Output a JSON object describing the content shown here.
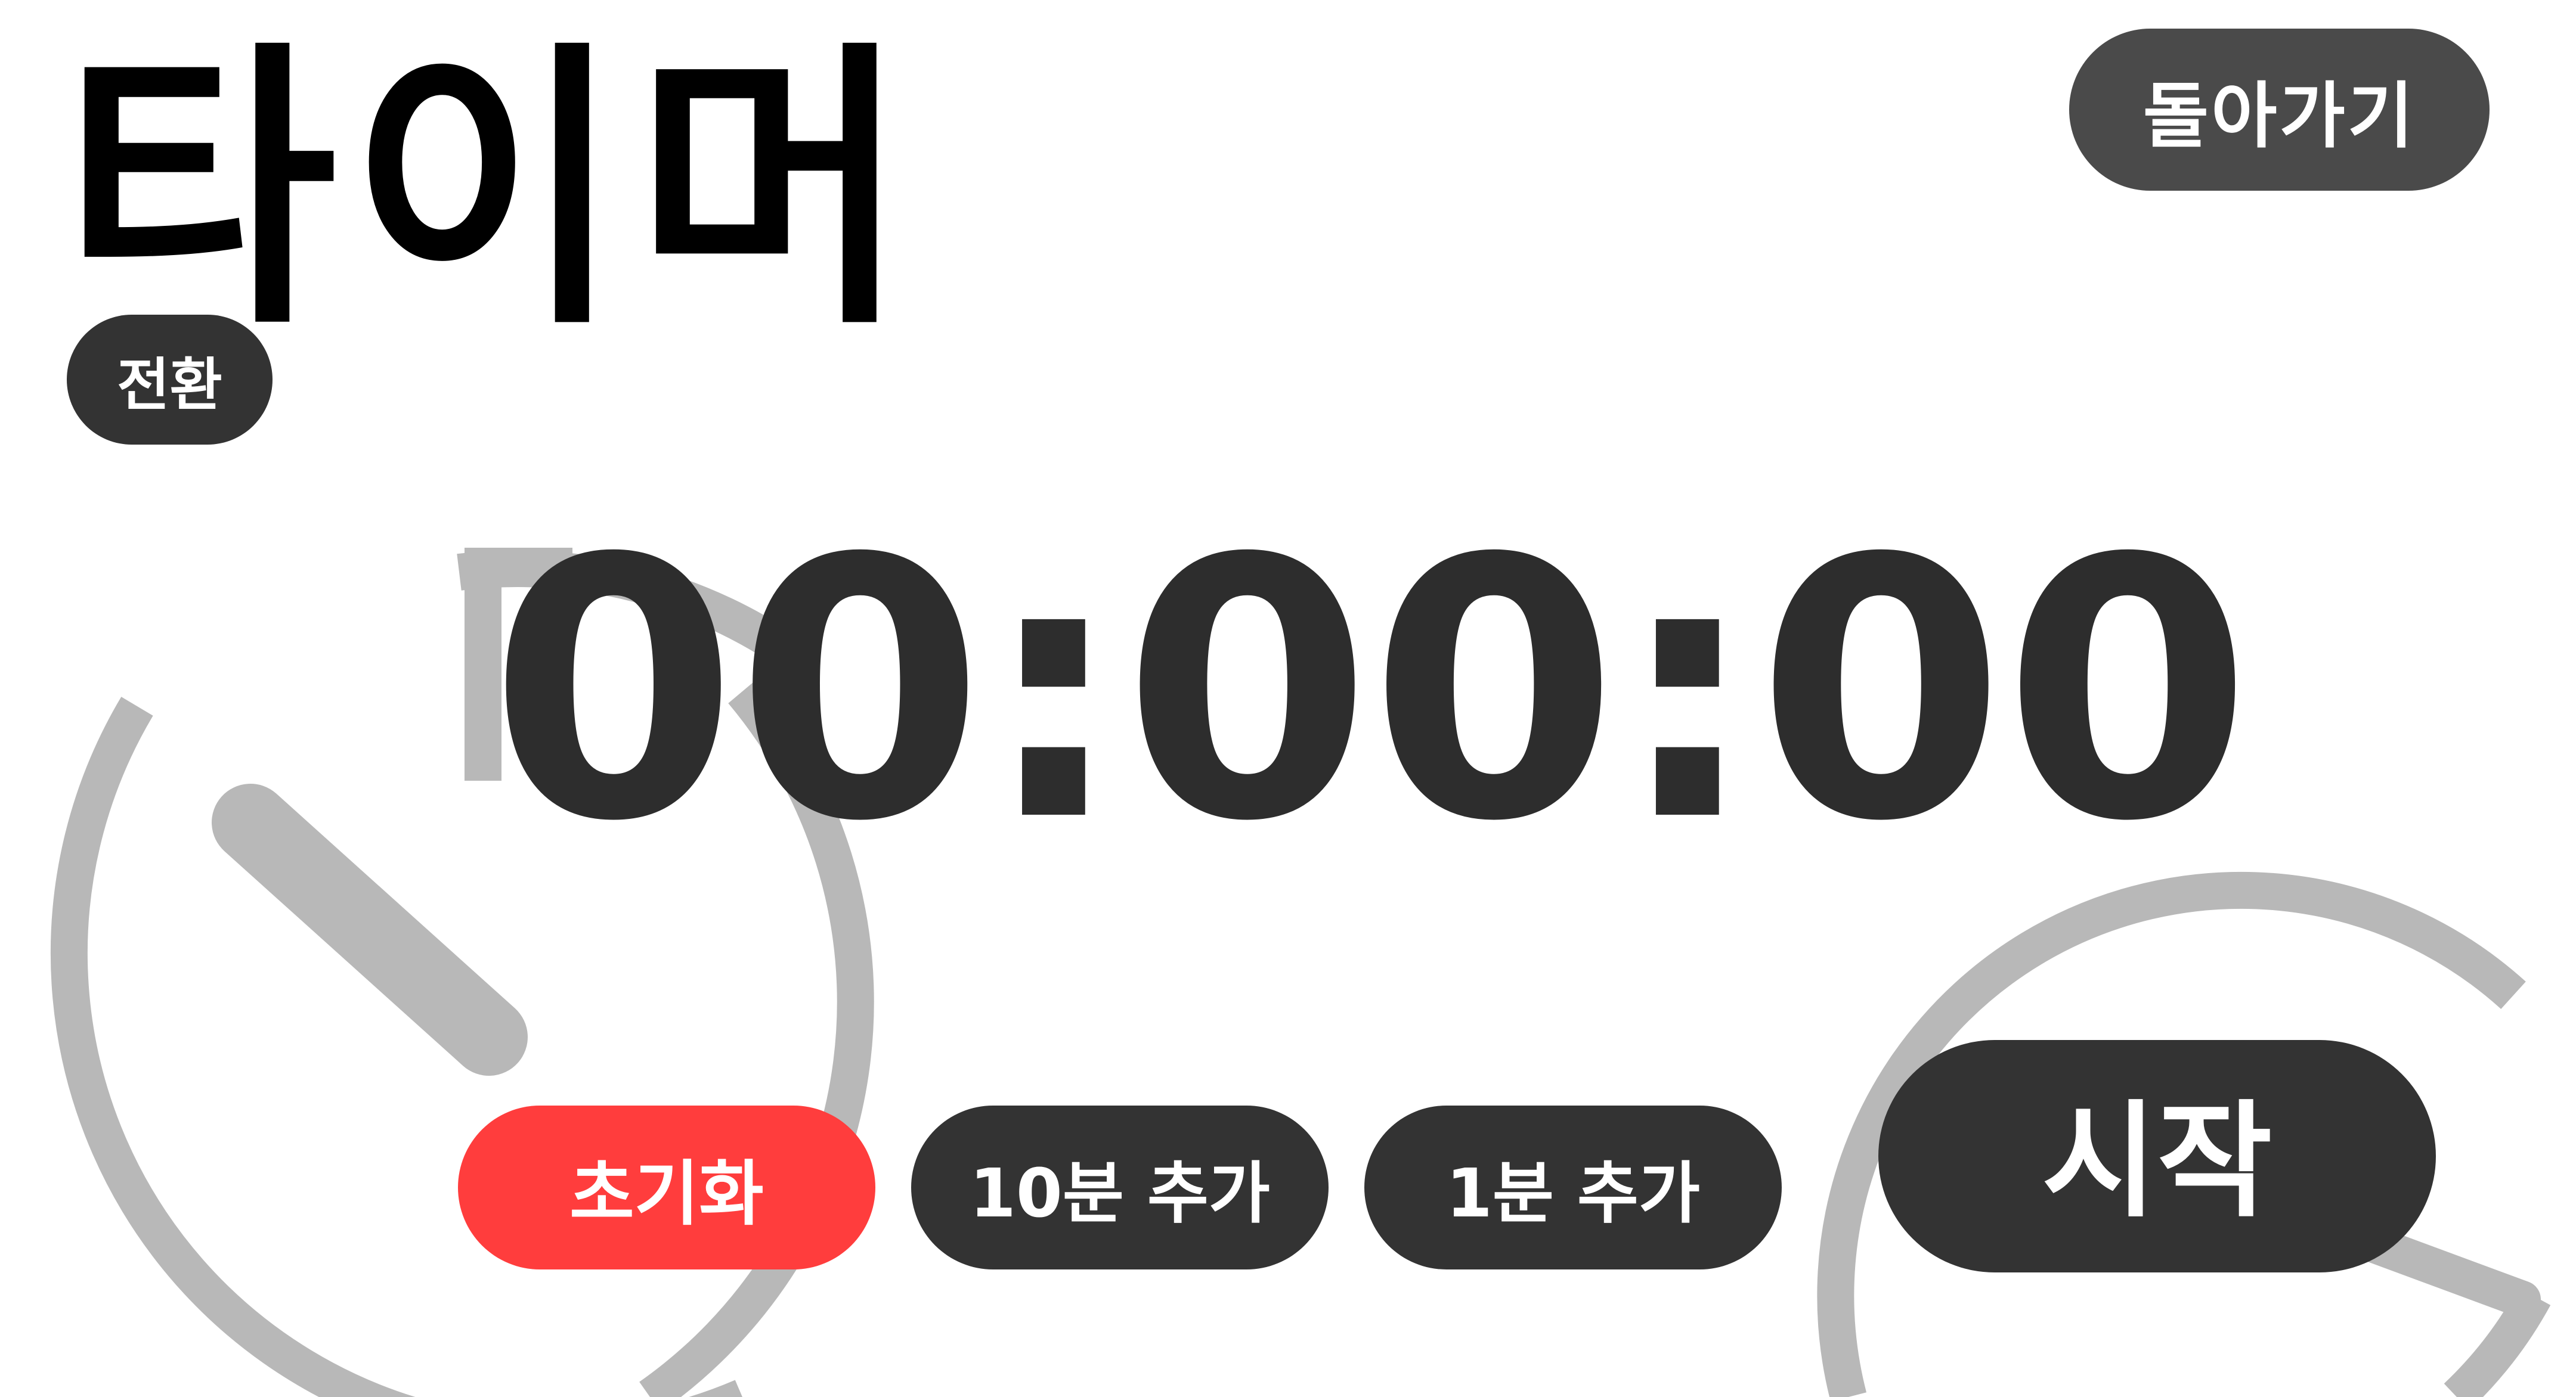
{
  "header": {
    "title": "타이머",
    "back_label": "돌아가기",
    "switch_label": "전환"
  },
  "timer": {
    "display": "00:00:00"
  },
  "controls": {
    "reset_label": "초기화",
    "add10_label": "10분 추가",
    "add1_label": "1분 추가",
    "start_label": "시작"
  },
  "colors": {
    "background": "#ffffff",
    "decor_gray": "#b8b8b8",
    "dark_button": "#333333",
    "back_button": "#4a4a4a",
    "reset_button": "#ff3d3d",
    "text_dark": "#2d2d2d"
  },
  "icons": {
    "stopwatch_left": "stopwatch-icon",
    "stopwatch_right": "stopwatch-icon"
  }
}
